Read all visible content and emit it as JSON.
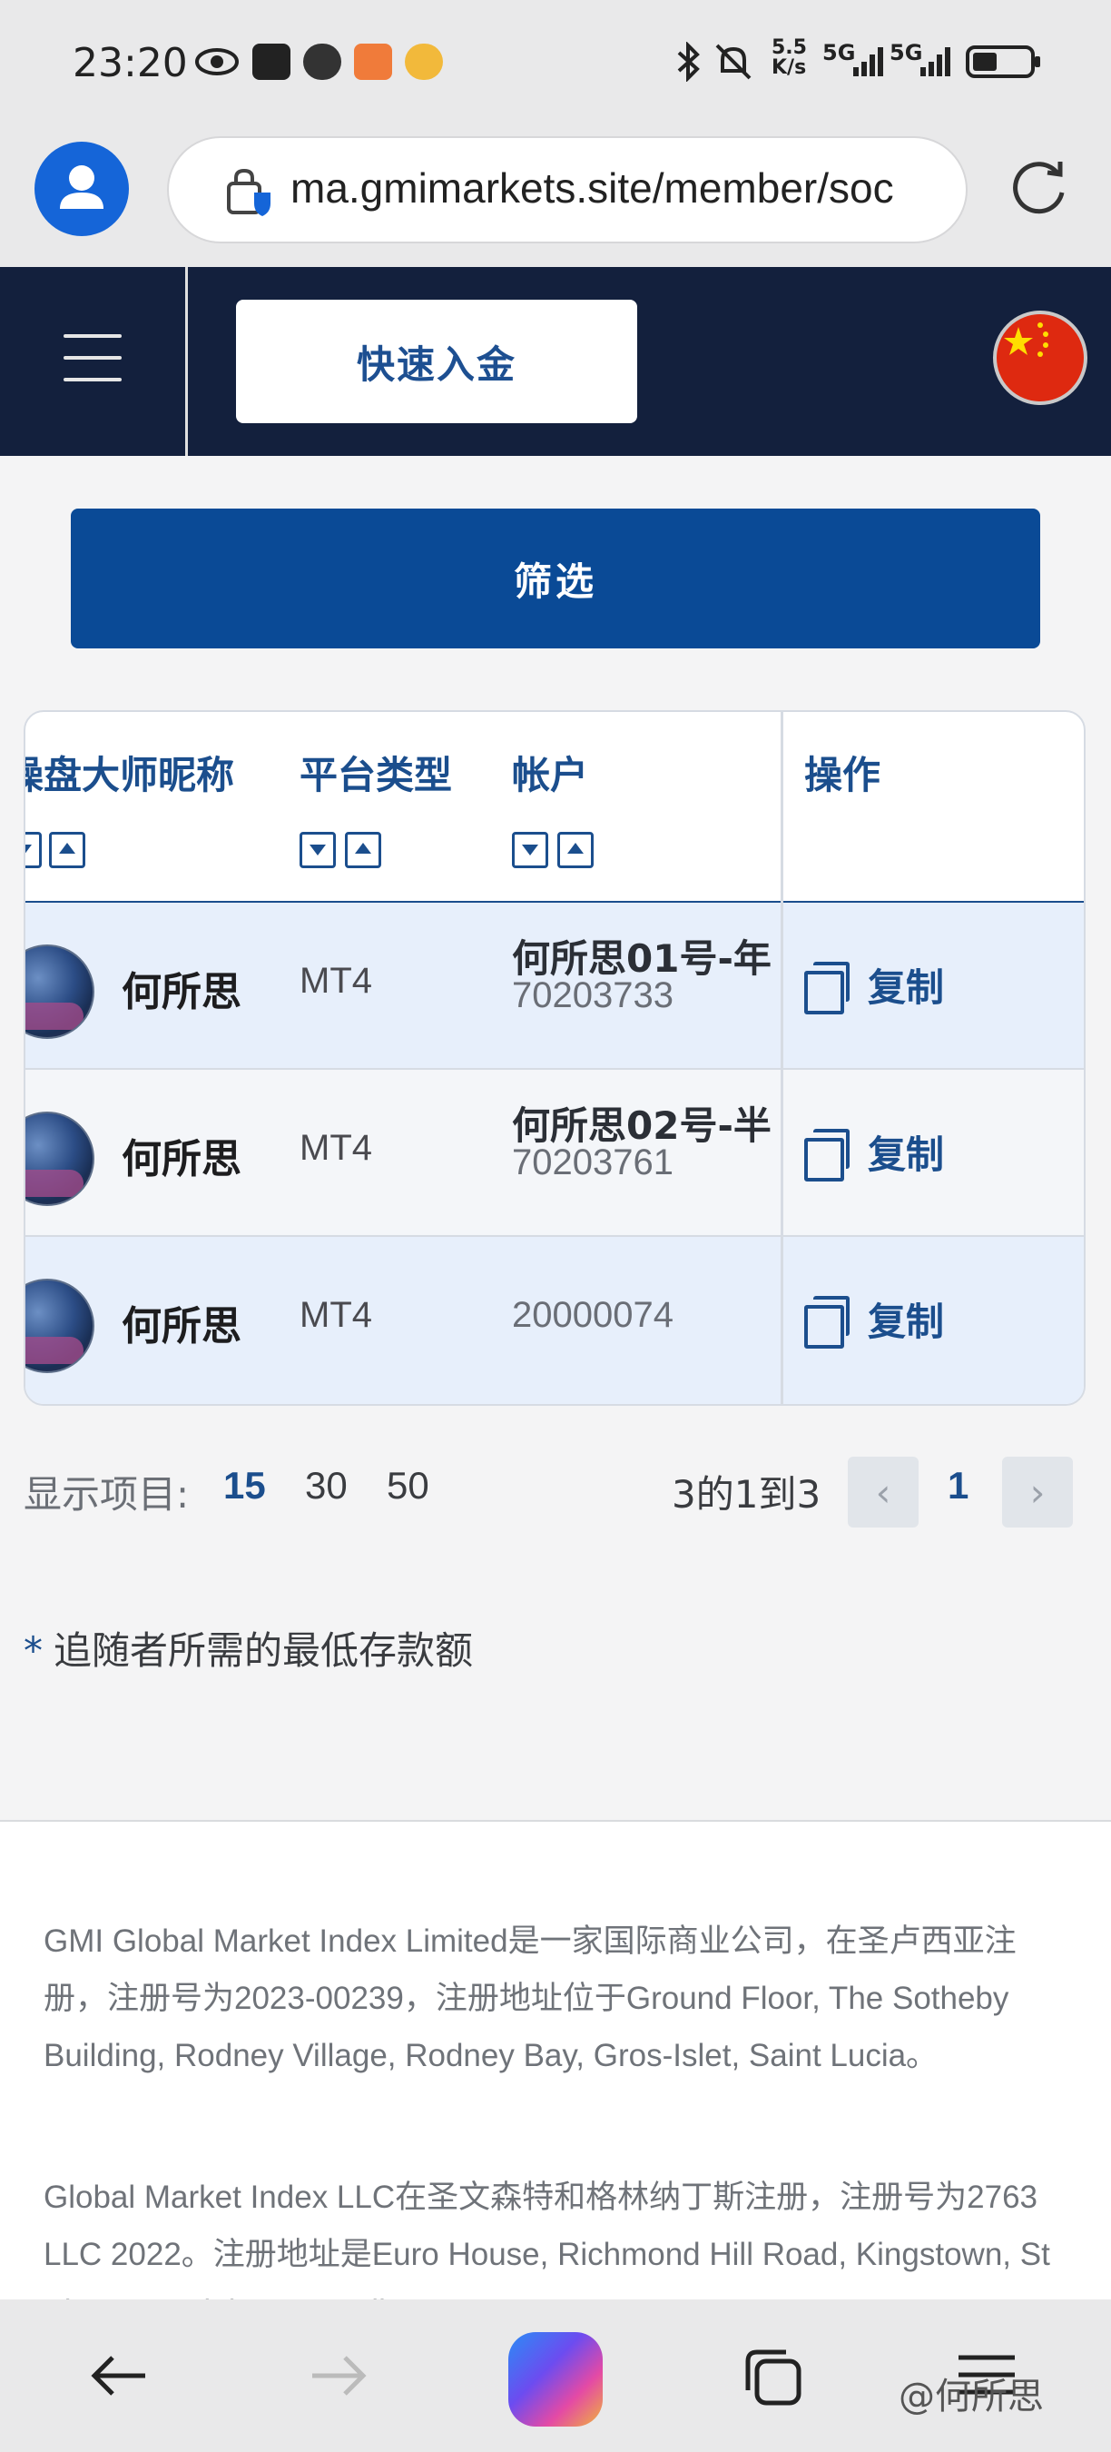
{
  "status_bar": {
    "time": "23:20",
    "net_speed": "5.5\nK/s",
    "signal_1": "5G",
    "signal_2": "5G"
  },
  "browser": {
    "url": "ma.gmimarkets.site/member/soc"
  },
  "header": {
    "quick_deposit_label": "快速入金"
  },
  "filter_label": "筛选",
  "table": {
    "headers": {
      "master_nickname": "操盘大师昵称",
      "platform_type": "平台类型",
      "account": "帐户",
      "actions": "操作"
    },
    "rows": [
      {
        "name": "何所思",
        "platform": "MT4",
        "account_title": "何所思01号-年",
        "account_number": "70203733",
        "action": "复制"
      },
      {
        "name": "何所思",
        "platform": "MT4",
        "account_title": "何所思02号-半",
        "account_number": "70203761",
        "action": "复制"
      },
      {
        "name": "何所思",
        "platform": "MT4",
        "account_title": "",
        "account_number": "20000074",
        "action": "复制"
      }
    ]
  },
  "pagination": {
    "show_label": "显示项目:",
    "sizes": [
      "15",
      "30",
      "50"
    ],
    "active_size": "15",
    "range_text": "3的1到3",
    "prev": "‹",
    "current_page": "1",
    "next": "›"
  },
  "note": {
    "star": "*",
    "text": "追随者所需的最低存款额"
  },
  "footer": {
    "paragraph_1": "GMI Global Market Index Limited是一家国际商业公司，在圣卢西亚注册，注册号为2023-00239，注册地址位于Ground Floor, The Sotheby Building, Rodney Village, Rodney Bay, Gros-Islet, Saint Lucia。",
    "paragraph_2": "Global Market Index LLC在圣文森特和格林纳丁斯注册，注册号为2763 LLC 2022。注册地址是Euro House, Richmond Hill Road, Kingstown, St Vincent and the Grenadines"
  },
  "bottom_nav": {
    "watermark": "@何所思"
  },
  "colors": {
    "nav_bg": "#13203d",
    "primary": "#0a4a96",
    "accent_text": "#1b4e8d",
    "row_tint": "#e7effb"
  },
  "icons": [
    "eye-icon",
    "nfc-icon",
    "alarm-icon",
    "heart-app-icon",
    "weibo-icon",
    "bluetooth-icon",
    "mute-icon",
    "battery-icon",
    "user-avatar-icon",
    "lock-shield-icon",
    "reload-icon",
    "menu-icon",
    "china-flag-icon",
    "sort-down-icon",
    "sort-up-icon",
    "copy-icon",
    "back-arrow-icon",
    "forward-arrow-icon",
    "copilot-icon",
    "tabs-icon",
    "menu-lines-icon"
  ]
}
